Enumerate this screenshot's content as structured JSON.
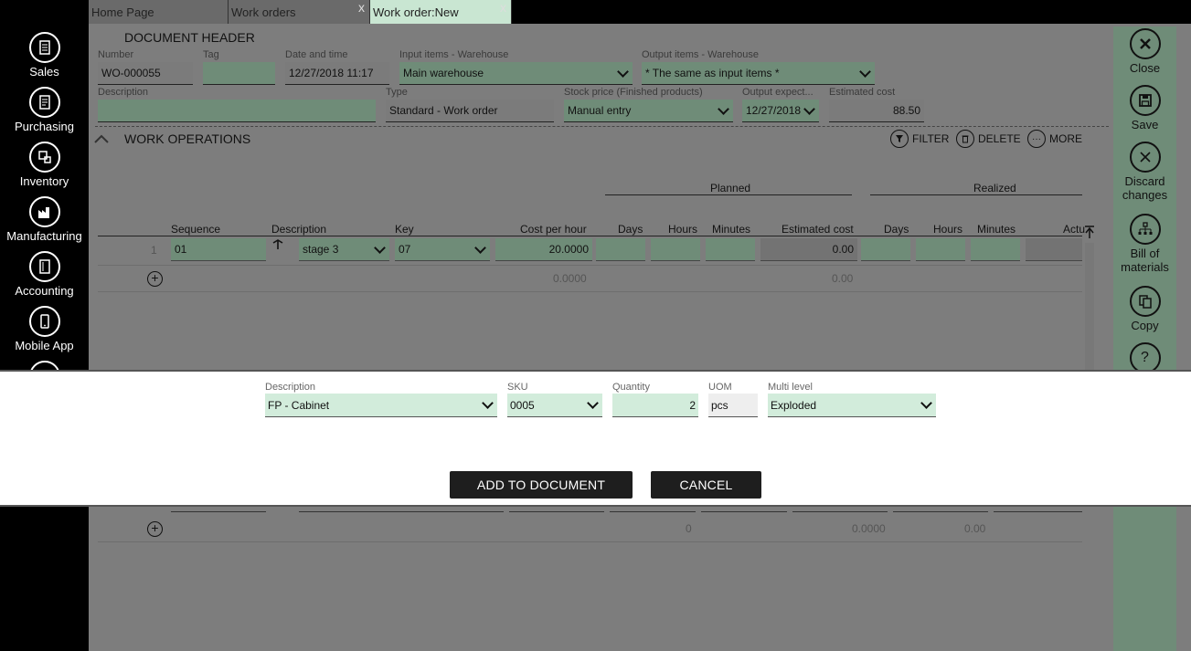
{
  "left_nav": {
    "items": [
      {
        "label": "Sales",
        "icon": "sales-icon"
      },
      {
        "label": "Purchasing",
        "icon": "purchasing-icon"
      },
      {
        "label": "Inventory",
        "icon": "inventory-icon"
      },
      {
        "label": "Manufacturing",
        "icon": "manufacturing-icon"
      },
      {
        "label": "Accounting",
        "icon": "accounting-icon"
      },
      {
        "label": "Mobile App",
        "icon": "mobile-icon"
      }
    ]
  },
  "tabs": [
    {
      "label": "Home Page",
      "closable": false
    },
    {
      "label": "Work orders",
      "closable": true
    },
    {
      "label": "Work order:New",
      "closable": true,
      "active": true
    }
  ],
  "tab_close_glyph": "x",
  "toolbar": {
    "items": [
      {
        "label": "Close",
        "icon": "close-icon"
      },
      {
        "label": "Save",
        "icon": "save-icon"
      },
      {
        "label": "Discard changes",
        "icon": "discard-icon"
      },
      {
        "label": "Bill of materials",
        "icon": "bill-of-materials-icon"
      },
      {
        "label": "Copy",
        "icon": "copy-icon"
      },
      {
        "label": "",
        "icon": "help-icon",
        "glyph": "?"
      }
    ]
  },
  "header": {
    "title": "DOCUMENT HEADER",
    "number": {
      "label": "Number",
      "value": "WO-000055"
    },
    "tag": {
      "label": "Tag",
      "value": ""
    },
    "datetime": {
      "label": "Date and time",
      "value": "12/27/2018 11:17"
    },
    "input_wh": {
      "label": "Input items - Warehouse",
      "value": "Main warehouse"
    },
    "output_wh": {
      "label": "Output items - Warehouse",
      "value": "* The same as input items *"
    },
    "description": {
      "label": "Description",
      "value": ""
    },
    "type": {
      "label": "Type",
      "value": "Standard - Work order"
    },
    "stock_price": {
      "label": "Stock price (Finished products)",
      "value": "Manual entry"
    },
    "output_expected": {
      "label": "Output expect...",
      "value": "12/27/2018"
    },
    "estimated_cost": {
      "label": "Estimated cost",
      "value": "88.50"
    }
  },
  "operations": {
    "title": "WORK OPERATIONS",
    "actions": {
      "filter": "FILTER",
      "delete": "DELETE",
      "more": "MORE"
    },
    "groups": {
      "planned": "Planned",
      "realized": "Realized"
    },
    "columns": {
      "sequence": "Sequence",
      "description": "Description",
      "key": "Key",
      "cost_per_hour": "Cost per hour",
      "days": "Days",
      "hours": "Hours",
      "minutes": "Minutes",
      "estimated_cost": "Estimated cost",
      "r_days": "Days",
      "r_hours": "Hours",
      "r_minutes": "Minutes",
      "actual": "Actu"
    },
    "row": {
      "index": "1",
      "sequence": "01",
      "description": "stage 3",
      "key": "07",
      "cost_per_hour": "20.0000",
      "estimated_cost": "0.00"
    },
    "totals": {
      "cost_per_hour": "0.0000",
      "estimated_cost": "0.00"
    }
  },
  "lower_totals": {
    "a": "0",
    "b": "0.0000",
    "c": "0.00"
  },
  "modal": {
    "description": {
      "label": "Description",
      "value": "FP - Cabinet"
    },
    "sku": {
      "label": "SKU",
      "value": "0005"
    },
    "quantity": {
      "label": "Quantity",
      "value": "2"
    },
    "uom": {
      "label": "UOM",
      "value": "pcs"
    },
    "multi_level": {
      "label": "Multi level",
      "value": "Exploded"
    },
    "add_button": "ADD TO DOCUMENT",
    "cancel_button": "CANCEL"
  }
}
